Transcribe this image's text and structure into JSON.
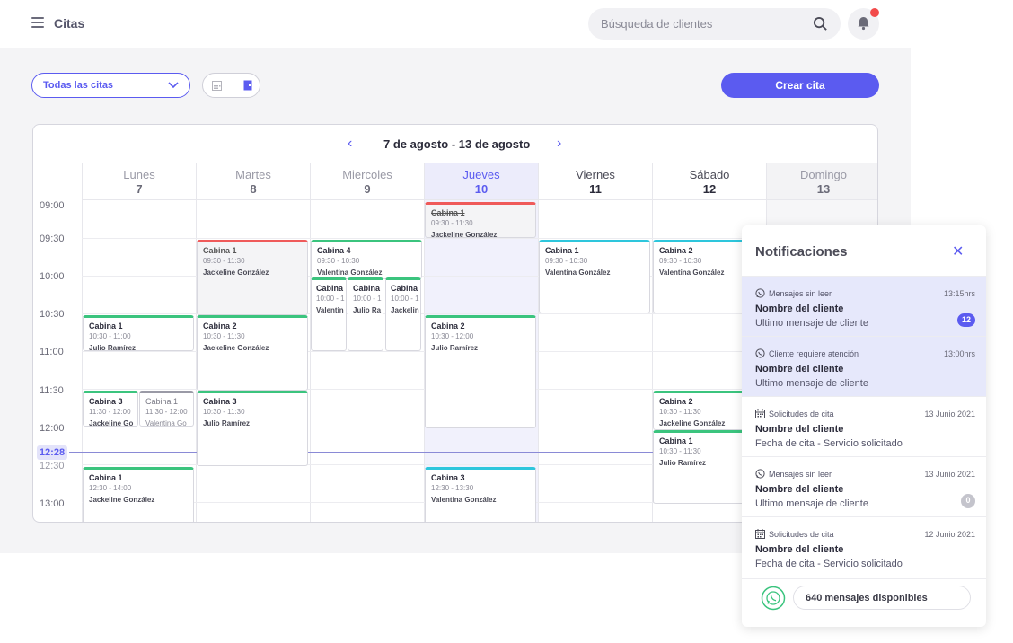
{
  "header": {
    "title": "Citas",
    "search_placeholder": "Búsqueda de clientes"
  },
  "toolbar": {
    "filter_label": "Todas las citas",
    "create_label": "Crear cita"
  },
  "calendar": {
    "range": "7 de agosto - 13 de agosto",
    "days": [
      {
        "name": "Lunes",
        "num": "7"
      },
      {
        "name": "Martes",
        "num": "8"
      },
      {
        "name": "Miercoles",
        "num": "9"
      },
      {
        "name": "Jueves",
        "num": "10"
      },
      {
        "name": "Viernes",
        "num": "11"
      },
      {
        "name": "Sábado",
        "num": "12"
      },
      {
        "name": "Domingo",
        "num": "13"
      }
    ],
    "times": [
      "09:00",
      "09:30",
      "10:00",
      "10:30",
      "11:00",
      "11:30",
      "12:00",
      "12:30",
      "13:00"
    ],
    "now": "12:28",
    "events": [
      {
        "name": "Cabina 1",
        "time": "09:30 - 11:30",
        "client": "Jackeline González"
      },
      {
        "name": "Cabina 1",
        "time": "09:30 - 11:30",
        "client": "Jackeline González"
      },
      {
        "name": "Cabina 4",
        "time": "09:30 - 10:30",
        "client": "Valentina González"
      },
      {
        "name": "Cabina",
        "time": "10:00 - 1",
        "client": "Valentin"
      },
      {
        "name": "Cabina",
        "time": "10:00 - 1",
        "client": "Julio Ra"
      },
      {
        "name": "Cabina",
        "time": "10:00 - 1",
        "client": "Jackelin"
      },
      {
        "name": "Cabina 1",
        "time": "09:30 - 10:30",
        "client": "Valentina González"
      },
      {
        "name": "Cabina 2",
        "time": "09:30 - 10:30",
        "client": "Valentina González"
      },
      {
        "name": "Cabina 1",
        "time": "10:30 - 11:00",
        "client": "Julio Ramírez"
      },
      {
        "name": "Cabina 2",
        "time": "10:30 - 11:30",
        "client": "Jackeline González"
      },
      {
        "name": "Cabina 2",
        "time": "10:30 - 12:00",
        "client": "Julio Ramírez"
      },
      {
        "name": "Cabina 3",
        "time": "11:30 - 12:00",
        "client": "Jackeline Go"
      },
      {
        "name": "Cabina 1",
        "time": "11:30 - 12:00",
        "client": "Valentina Go"
      },
      {
        "name": "Cabina 3",
        "time": "10:30 - 11:30",
        "client": "Julio Ramírez"
      },
      {
        "name": "Cabina 2",
        "time": "10:30 - 11:30",
        "client": "Jackeline González"
      },
      {
        "name": "Cabina 1",
        "time": "10:30 - 11:30",
        "client": "Julio Ramírez"
      },
      {
        "name": "Cabina 1",
        "time": "12:30 - 14:00",
        "client": "Jackeline González"
      },
      {
        "name": "Cabina 3",
        "time": "12:30 - 13:30",
        "client": "Valentina González"
      }
    ]
  },
  "notifications": {
    "title": "Notificaciones",
    "items": [
      {
        "type": "Mensajes sin leer",
        "date": "13:15hrs",
        "title": "Nombre del cliente",
        "subtitle": "Ultimo mensaje de cliente",
        "badge": "12",
        "icon": "whatsapp-icon"
      },
      {
        "type": "Cliente requiere atención",
        "date": "13:00hrs",
        "title": "Nombre del cliente",
        "subtitle": "Ultimo mensaje de cliente",
        "badge": "",
        "icon": "whatsapp-icon"
      },
      {
        "type": "Solicitudes de cita",
        "date": "13 Junio 2021",
        "title": "Nombre del cliente",
        "subtitle": "Fecha de cita - Servicio solicitado",
        "badge": "",
        "icon": "calendar-icon"
      },
      {
        "type": "Mensajes sin leer",
        "date": "13 Junio 2021",
        "title": "Nombre del cliente",
        "subtitle": "Ultimo mensaje de cliente",
        "badge": "0",
        "icon": "whatsapp-icon"
      },
      {
        "type": "Solicitudes de cita",
        "date": "12 Junio 2021",
        "title": "Nombre del cliente",
        "subtitle": "Fecha de cita - Servicio solicitado",
        "badge": "",
        "icon": "calendar-icon"
      }
    ],
    "footer": "640 mensajes disponibles"
  },
  "colors": {
    "accent": "#5b5bf0",
    "event_green": "#3bc47e",
    "event_red": "#ef5a5a",
    "event_cyan": "#2ec6dc",
    "badge_blue": "#5b5bf0",
    "badge_gray": "#c4c4cc",
    "notify_dot": "#f24b4b"
  }
}
